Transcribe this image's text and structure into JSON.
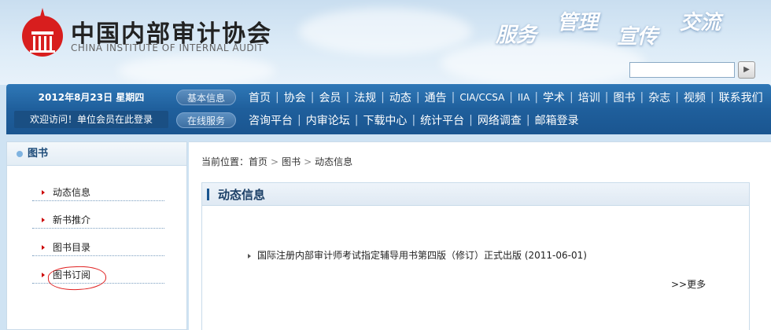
{
  "header": {
    "name_cn": "中国内部审计协会",
    "name_en": "CHINA INSTITUTE OF INTERNAL AUDIT",
    "slogans": [
      "服务",
      "管理",
      "宣传",
      "交流"
    ],
    "search_button": "▶"
  },
  "nav": {
    "date": "2012年8月23日   星期四",
    "welcome": "欢迎访问！单位会员在此登录",
    "row1_tag": "基本信息",
    "row1_items": [
      "首页",
      "协会",
      "会员",
      "法规",
      "动态",
      "通告",
      "CIA/CCSA",
      "IIA",
      "学术",
      "培训",
      "图书",
      "杂志",
      "视频",
      "联系我们"
    ],
    "row2_tag": "在线服务",
    "row2_items": [
      "咨询平台",
      "内审论坛",
      "下载中心",
      "统计平台",
      "网络调查",
      "邮箱登录"
    ]
  },
  "sidebar": {
    "title": "图书",
    "items": [
      "动态信息",
      "新书推介",
      "图书目录",
      "图书订阅"
    ]
  },
  "breadcrumb": {
    "prefix": "当前位置：",
    "items": [
      "首页",
      "图书",
      "动态信息"
    ]
  },
  "panel": {
    "title": "动态信息",
    "news": [
      "国际注册内部审计师考试指定辅导用书第四版（修订）正式出版 (2011-06-01)"
    ],
    "more": ">>更多"
  },
  "colors": {
    "nav_blue": "#1f5f9c",
    "accent_red": "#c00000",
    "highlight_circle": "#e02020"
  }
}
